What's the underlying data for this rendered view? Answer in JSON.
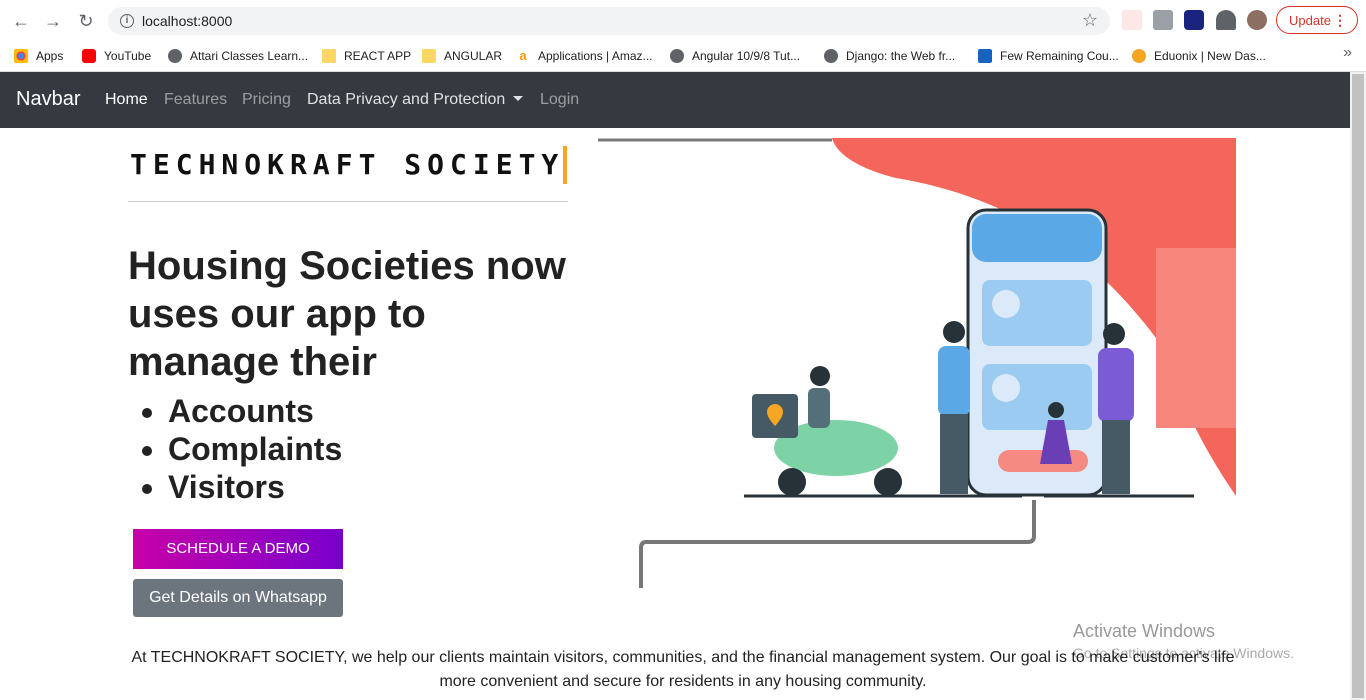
{
  "browser": {
    "url": "localhost:8000",
    "update_label": "Update"
  },
  "bookmarks": [
    {
      "label": "Apps",
      "color": "#4285f4"
    },
    {
      "label": "YouTube",
      "color": "#ff0000"
    },
    {
      "label": "Attari Classes Learn...",
      "color": "#5f6368"
    },
    {
      "label": "REACT APP",
      "color": "#fdd663"
    },
    {
      "label": "ANGULAR",
      "color": "#fdd663"
    },
    {
      "label": "Applications | Amaz...",
      "color": "#ff9900"
    },
    {
      "label": "Angular 10/9/8 Tut...",
      "color": "#5f6368"
    },
    {
      "label": "Django: the Web fr...",
      "color": "#5f6368"
    },
    {
      "label": "Few Remaining Cou...",
      "color": "#1565c0"
    },
    {
      "label": "Eduonix | New Das...",
      "color": "#f5a623"
    }
  ],
  "navbar": {
    "brand": "Navbar",
    "links": [
      "Home",
      "Features",
      "Pricing",
      "Data Privacy and Protection",
      "Login"
    ]
  },
  "hero": {
    "typewriter": "TECHNOKRAFT SOCIETY",
    "headline": "Housing Societies now uses our app to manage their",
    "features": [
      "Accounts",
      "Complaints",
      "Visitors"
    ],
    "demo_button": "SCHEDULE A DEMO",
    "whatsapp_button": "Get Details on Whatsapp"
  },
  "footer": {
    "text": "At TECHNOKRAFT SOCIETY, we help our clients maintain visitors, communities, and the financial management system. Our goal is to make customer's life more convenient and secure for residents in any housing community."
  },
  "watermark": {
    "title": "Activate Windows",
    "subtitle": "Go to Settings to activate Windows."
  }
}
